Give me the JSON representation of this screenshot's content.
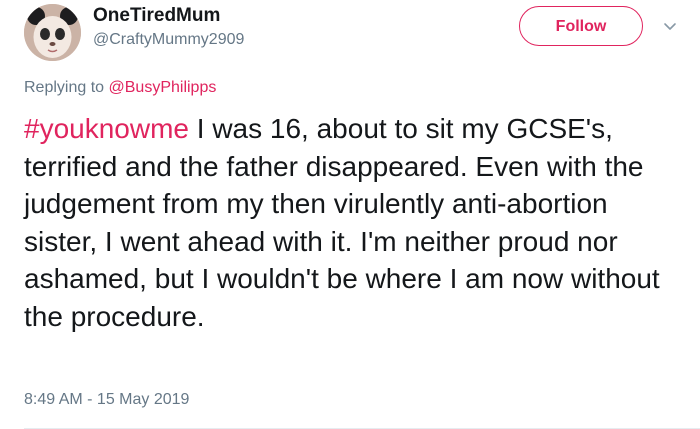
{
  "tweet": {
    "author": {
      "display_name": "OneTiredMum",
      "handle": "@CraftyMummy2909",
      "avatar_icon": "panda-filter-avatar"
    },
    "follow_button": {
      "label": "Follow",
      "color": "#e0245e"
    },
    "menu_icon": "chevron-down-icon",
    "reply": {
      "prefix": "Replying to",
      "mention": "@BusyPhilipps"
    },
    "hashtag": "#youknowme",
    "body": " I was 16, about to sit my GCSE's, terrified and the father disappeared. Even with the judgement from my then virulently anti-abortion sister, I went ahead with it. I'm neither proud nor ashamed, but I wouldn't be where I am now without the procedure.",
    "timestamp": "8:49 AM - 15 May 2019"
  },
  "colors": {
    "accent": "#e0245e",
    "secondary_text": "#657786",
    "primary_text": "#14171a"
  }
}
